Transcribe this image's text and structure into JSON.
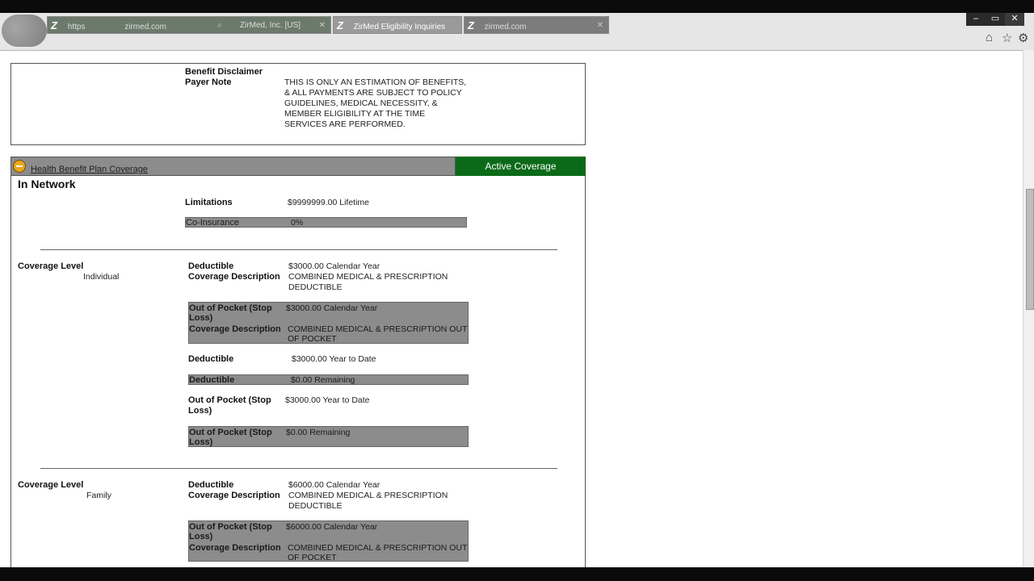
{
  "browser": {
    "tab1_url": "https",
    "tab1_host": "zirmed.com",
    "tab1_title": "ZirMed, Inc. [US]",
    "tab2_title": "ZirMed Eligibility Inquiries",
    "tab3_title": "zirmed.com",
    "window_buttons": [
      "–",
      "▭",
      "✕"
    ],
    "tool_icons": [
      "home-icon",
      "star-icon",
      "gear-icon"
    ]
  },
  "disclaimer": {
    "title": "Benefit Disclaimer",
    "payer_note_label": "Payer Note",
    "payer_note_lines": [
      "THIS IS ONLY AN ESTIMATION OF BENEFITS,",
      "& ALL PAYMENTS ARE SUBJECT TO POLICY",
      "GUIDELINES, MEDICAL NECESSITY, &",
      "MEMBER ELIGIBILITY AT THE TIME",
      "SERVICES ARE PERFORMED."
    ]
  },
  "coverage_header": {
    "title": "Health Benefit Plan Coverage",
    "status": "Active Coverage",
    "status_color": "#0b6a18"
  },
  "network": "In Network",
  "limitations": {
    "label": "Limitations",
    "value": "$9999999.00 Lifetime"
  },
  "coinsurance": {
    "label": "Co-Insurance",
    "value": "0%"
  },
  "individual": {
    "level_label": "Coverage Level",
    "level_value": "Individual",
    "ded_label": "Deductible",
    "ded_value": "$3000.00 Calendar Year",
    "desc_label": "Coverage Description",
    "desc_line1": "COMBINED MEDICAL & PRESCRIPTION",
    "desc_line2": "DEDUCTIBLE",
    "oop_label1": "Out of Pocket (Stop",
    "oop_label2": "Loss)",
    "oop_value": "$3000.00 Calendar Year",
    "oop_desc_label": "Coverage Description",
    "oop_desc_line1": "COMBINED MEDICAL & PRESCRIPTION OUT",
    "oop_desc_line2": "OF POCKET",
    "ytd_ded_label": "Deductible",
    "ytd_ded_value": "$3000.00 Year to Date",
    "rem_ded_label": "Deductible",
    "rem_ded_value": "$0.00 Remaining",
    "ytd_oop_label1": "Out of Pocket (Stop",
    "ytd_oop_label2": "Loss)",
    "ytd_oop_value": "$3000.00 Year to Date",
    "rem_oop_label1": "Out of Pocket (Stop",
    "rem_oop_label2": "Loss)",
    "rem_oop_value": "$0.00 Remaining"
  },
  "family": {
    "level_label": "Coverage Level",
    "level_value": "Family",
    "ded_label": "Deductible",
    "ded_value": "$6000.00 Calendar Year",
    "desc_label": "Coverage Description",
    "desc_line1": "COMBINED MEDICAL & PRESCRIPTION",
    "desc_line2": "DEDUCTIBLE",
    "oop_label1": "Out of Pocket (Stop",
    "oop_label2": "Loss)",
    "oop_value": "$6000.00 Calendar Year",
    "oop_desc_label": "Coverage Description",
    "oop_desc_line1": "COMBINED MEDICAL & PRESCRIPTION OUT",
    "oop_desc_line2": "OF POCKET"
  }
}
